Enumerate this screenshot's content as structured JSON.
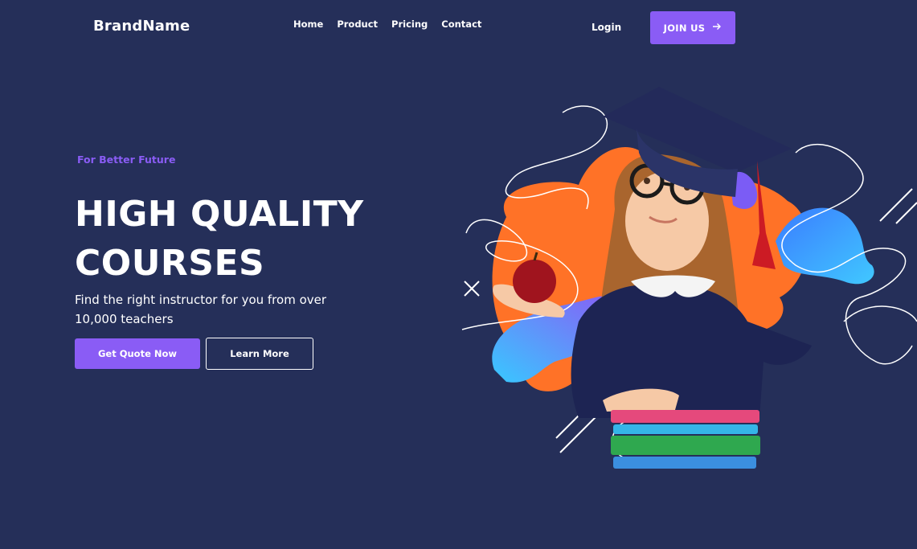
{
  "header": {
    "brand": "BrandName",
    "nav": [
      "Home",
      "Product",
      "Pricing",
      "Contact"
    ],
    "login": "Login",
    "join": "JOIN US",
    "join_icon": "arrow-right-icon"
  },
  "hero": {
    "tagline": "For Better Future",
    "headline_line1": "HIGH QUALITY",
    "headline_line2": "COURSES",
    "subtext": "Find the right instructor for you from over 10,000 teachers",
    "primary_button": "Get Quote Now",
    "secondary_button": "Learn More"
  },
  "colors": {
    "background": "#252f59",
    "accent": "#8a5cf5",
    "blob_orange": "#ff7227",
    "blob_blue": "#3ab6ff"
  }
}
